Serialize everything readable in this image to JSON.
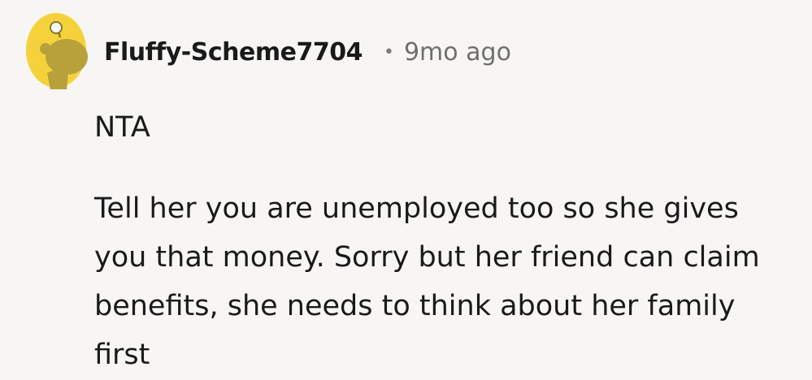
{
  "comment": {
    "author": "Fluffy-Scheme7704",
    "separator": "•",
    "timestamp": "9mo ago",
    "paragraphs": [
      "NTA",
      "Tell her you are unemployed too so she gives you that money. Sorry but her friend can claim benefits, she needs to think about her family first"
    ]
  },
  "avatar": {
    "icon": "snoo-avatar-icon",
    "background_color": "#f5d23b",
    "figure_color": "#b8a03a"
  }
}
